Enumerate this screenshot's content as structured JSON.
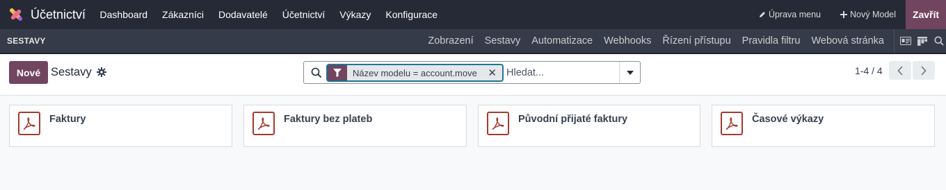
{
  "topbar": {
    "app_title": "Účetnictví",
    "menu": [
      "Dashboard",
      "Zákazníci",
      "Dodavatelé",
      "Účetnictví",
      "Výkazy",
      "Konfigurace"
    ],
    "edit_menu": "Úprava menu",
    "new_model": "Nový Model",
    "close": "Zavřít"
  },
  "subbar": {
    "title": "SESTAVY",
    "links": [
      "Zobrazení",
      "Sestavy",
      "Automatizace",
      "Webhooks",
      "Řízení přístupu",
      "Pravidla filtru",
      "Webová stránka"
    ]
  },
  "control": {
    "new_button": "Nové",
    "breadcrumb": "Sestavy",
    "facet": "Název modelu = account.move",
    "search_placeholder": "Hledat...",
    "pager": "1-4 / 4"
  },
  "cards": [
    "Faktury",
    "Faktury bez plateb",
    "Původní přijaté faktury",
    "Časové výkazy"
  ],
  "colors": {
    "navbar": "#262a36",
    "subbar": "#353b48",
    "brand": "#71445f",
    "pdf": "#a33a2e"
  }
}
